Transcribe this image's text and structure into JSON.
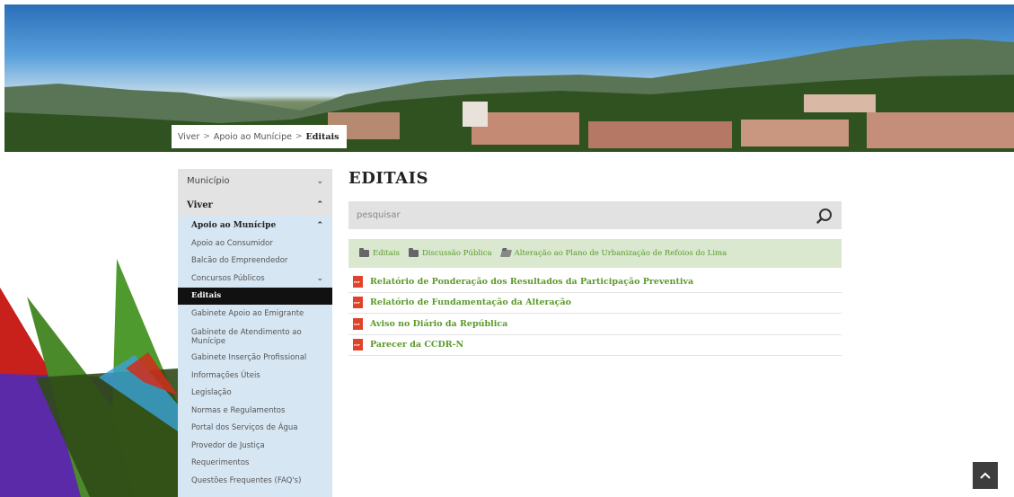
{
  "breadcrumb": {
    "items": [
      "Viver",
      "Apoio ao Munícipe"
    ],
    "current": "Editais",
    "separator": ">"
  },
  "sidebar": {
    "top_item": "Município",
    "section": "Viver",
    "subsection": "Apoio ao Munícipe",
    "items": [
      "Apoio ao Consumidor",
      "Balcão do Empreendedor",
      "Concursos Públicos",
      "Editais",
      "Gabinete Apoio ao Emigrante",
      "Gabinete de Atendimento ao Munícipe",
      "Gabinete Inserção Profissional",
      "Informações Úteis",
      "Legislação",
      "Normas e Regulamentos",
      "Portal dos Serviços de Água",
      "Provedor de Justiça",
      "Requerimentos",
      "Questões Frequentes (FAQ's)"
    ],
    "active_item": "Editais"
  },
  "main": {
    "title": "EDITAIS",
    "search": {
      "placeholder": "pesquisar",
      "value": ""
    },
    "folders": [
      "Editais",
      "Discussão Pública",
      "Alteração ao Plano de Urbanização de Refoios do Lima"
    ],
    "documents": [
      "Relatório de Ponderação dos Resultados da Participação Preventiva",
      "Relatório de Fundamentação da Alteração",
      "Aviso no Diário da República",
      "Parecer da CCDR-N"
    ]
  },
  "icons": {
    "search": "search-icon",
    "chevron": "chevron-down-icon",
    "folder": "folder-icon",
    "pdf": "pdf-icon",
    "scroll_top": "chevron-up-icon"
  },
  "colors": {
    "link_green": "#5c9a2c",
    "sidebar_bg": "#d6e6f3",
    "active_bg": "#111111",
    "folder_bar_bg": "#d9e8cf",
    "pdf_red": "#e0432a"
  }
}
